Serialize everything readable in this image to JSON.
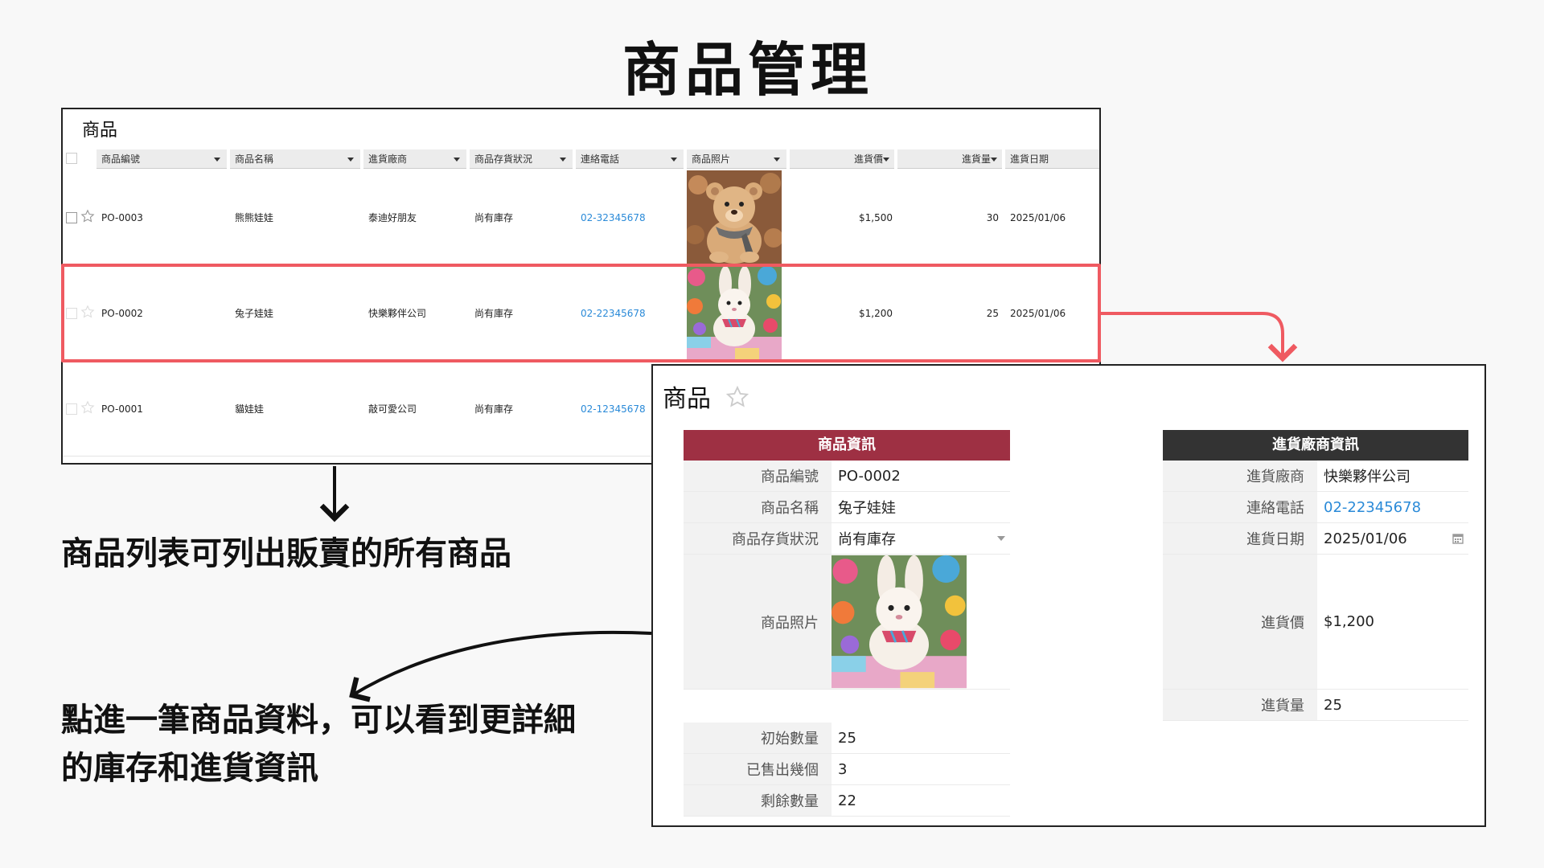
{
  "title": "商品管理",
  "list": {
    "panel_title": "商品",
    "columns": [
      {
        "label": "商品編號"
      },
      {
        "label": "商品名稱"
      },
      {
        "label": "進貨廠商"
      },
      {
        "label": "商品存貨狀況"
      },
      {
        "label": "連絡電話"
      },
      {
        "label": "商品照片"
      },
      {
        "label": "進貨價"
      },
      {
        "label": "進貨量"
      },
      {
        "label": "進貨日期"
      }
    ],
    "rows": [
      {
        "id": "PO-0003",
        "name": "熊熊娃娃",
        "vendor": "泰迪好朋友",
        "stock": "尚有庫存",
        "phone": "02-32345678",
        "photo": "teddy-bear",
        "price": "$1,500",
        "qty": "30",
        "date": "2025/01/06"
      },
      {
        "id": "PO-0002",
        "name": "兔子娃娃",
        "vendor": "快樂夥伴公司",
        "stock": "尚有庫存",
        "phone": "02-22345678",
        "photo": "bunny",
        "price": "$1,200",
        "qty": "25",
        "date": "2025/01/06"
      },
      {
        "id": "PO-0001",
        "name": "貓娃娃",
        "vendor": "敲可愛公司",
        "stock": "尚有庫存",
        "phone": "02-12345678",
        "photo": "",
        "price": "",
        "qty": "",
        "date": ""
      }
    ]
  },
  "detail": {
    "panel_title": "商品",
    "product_section": {
      "header": "商品資訊",
      "fields": [
        {
          "label": "商品編號",
          "value": "PO-0002"
        },
        {
          "label": "商品名稱",
          "value": "兔子娃娃"
        },
        {
          "label": "商品存貨狀況",
          "value": "尚有庫存"
        },
        {
          "label": "商品照片",
          "value": ""
        }
      ],
      "stats": [
        {
          "label": "初始數量",
          "value": "25"
        },
        {
          "label": "已售出幾個",
          "value": "3"
        },
        {
          "label": "剩餘數量",
          "value": "22"
        }
      ]
    },
    "vendor_section": {
      "header": "進貨廠商資訊",
      "fields": [
        {
          "label": "進貨廠商",
          "value": "快樂夥伴公司"
        },
        {
          "label": "連絡電話",
          "value": "02-22345678"
        },
        {
          "label": "進貨日期",
          "value": "2025/01/06"
        },
        {
          "label": "進貨價",
          "value": "$1,200"
        },
        {
          "label": "進貨量",
          "value": "25"
        }
      ]
    }
  },
  "captions": {
    "list_caption": "商品列表可列出販賣的所有商品",
    "detail_caption_line1": "點進一筆商品資料，可以看到更詳細",
    "detail_caption_line2": "的庫存和進貨資訊"
  },
  "colors": {
    "highlight": "#ef5a61",
    "product_header": "#9e3043",
    "vendor_header": "#333333",
    "link": "#2a8ad8"
  }
}
